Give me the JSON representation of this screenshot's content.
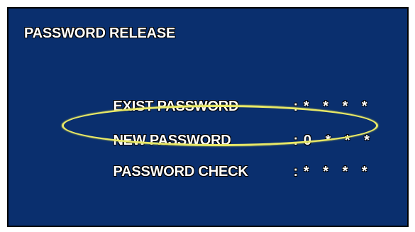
{
  "dialog": {
    "title": "PASSWORD RELEASE",
    "rows": [
      {
        "label": "EXIST PASSWORD",
        "separator": ":",
        "value": "* * * *"
      },
      {
        "label": "NEW PASSWORD",
        "separator": ":",
        "value": "0 * * *"
      },
      {
        "label": "PASSWORD CHECK",
        "separator": ":",
        "value": "* * * *"
      }
    ]
  },
  "colors": {
    "background": "#0a2f6e",
    "text": "#ffffff",
    "highlight": "#e8e866"
  }
}
